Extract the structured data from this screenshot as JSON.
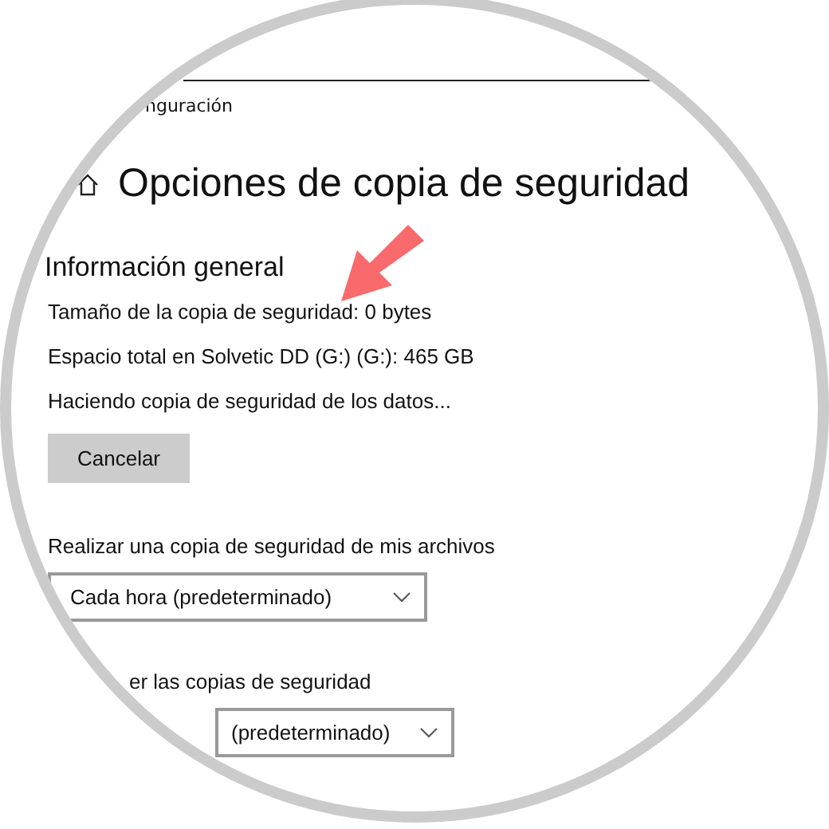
{
  "breadcrumb": "nguración",
  "title": "Opciones de copia de seguridad",
  "overview": {
    "heading": "Información general",
    "lines": [
      "Tamaño de la copia de seguridad: 0 bytes",
      "Espacio total en Solvetic DD (G:) (G:): 465 GB",
      "Haciendo copia de seguridad de los datos..."
    ],
    "button": "Cancelar"
  },
  "settings": [
    {
      "label": "Realizar una copia de seguridad de mis archivos",
      "value": "Cada hora (predeterminado)"
    },
    {
      "label": "er las copias de seguridad",
      "value": "(predeterminado)"
    }
  ]
}
